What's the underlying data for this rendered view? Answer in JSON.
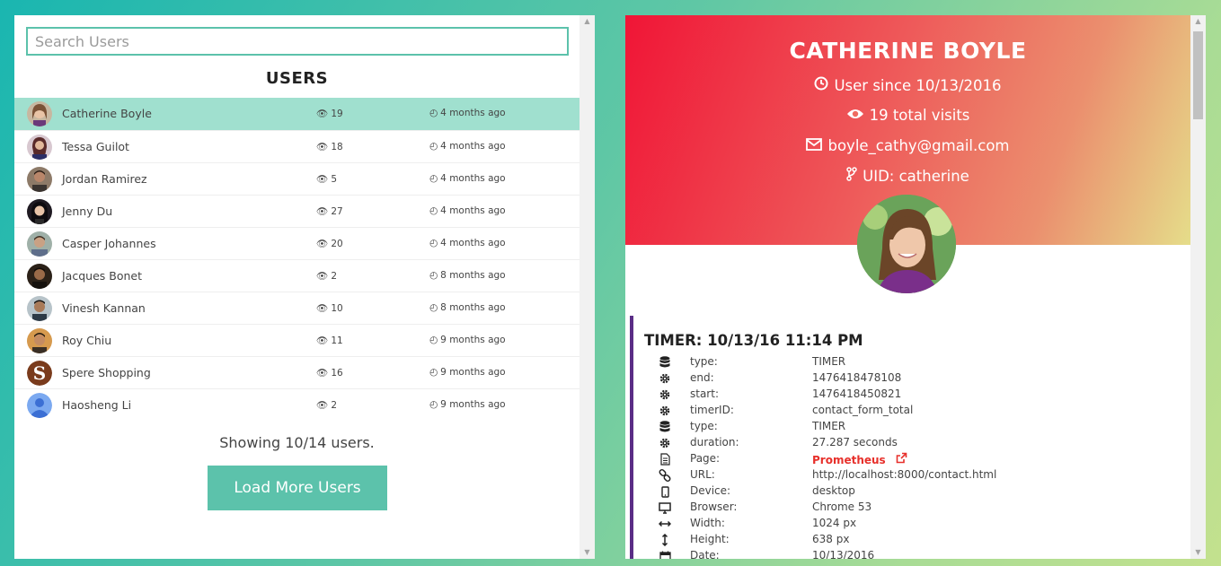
{
  "search": {
    "placeholder": "Search Users"
  },
  "users_title": "USERS",
  "users": [
    {
      "name": "Catherine Boyle",
      "visits": "19",
      "last_seen": "4 months ago",
      "selected": true
    },
    {
      "name": "Tessa Guilot",
      "visits": "18",
      "last_seen": "4 months ago"
    },
    {
      "name": "Jordan Ramirez",
      "visits": "5",
      "last_seen": "4 months ago"
    },
    {
      "name": "Jenny Du",
      "visits": "27",
      "last_seen": "4 months ago"
    },
    {
      "name": "Casper Johannes",
      "visits": "20",
      "last_seen": "4 months ago"
    },
    {
      "name": "Jacques Bonet",
      "visits": "2",
      "last_seen": "8 months ago"
    },
    {
      "name": "Vinesh Kannan",
      "visits": "10",
      "last_seen": "8 months ago"
    },
    {
      "name": "Roy Chiu",
      "visits": "11",
      "last_seen": "9 months ago"
    },
    {
      "name": "Spere Shopping",
      "visits": "16",
      "last_seen": "9 months ago"
    },
    {
      "name": "Haosheng Li",
      "visits": "2",
      "last_seen": "9 months ago"
    }
  ],
  "showing_text": "Showing 10/14 users.",
  "load_more_label": "Load More Users",
  "profile": {
    "name": "CATHERINE BOYLE",
    "user_since": "User since 10/13/2016",
    "total_visits": "19 total visits",
    "email": "boyle_cathy@gmail.com",
    "uid": "UID: catherine"
  },
  "event": {
    "title": "TIMER: 10/13/16 11:14 PM",
    "rows": [
      {
        "icon": "database-icon",
        "key": "type:",
        "value": "TIMER"
      },
      {
        "icon": "gear-icon",
        "key": "end:",
        "value": "1476418478108"
      },
      {
        "icon": "gear-icon",
        "key": "start:",
        "value": "1476418450821"
      },
      {
        "icon": "gear-icon",
        "key": "timerID:",
        "value": "contact_form_total"
      },
      {
        "icon": "database-icon",
        "key": "type:",
        "value": "TIMER"
      },
      {
        "icon": "gear-icon",
        "key": "duration:",
        "value": "27.287 seconds"
      },
      {
        "icon": "file-icon",
        "key": "Page:",
        "value": "Prometheus",
        "link": true
      },
      {
        "icon": "link-icon",
        "key": "URL:",
        "value": "http://localhost:8000/contact.html"
      },
      {
        "icon": "mobile-icon",
        "key": "Device:",
        "value": "desktop"
      },
      {
        "icon": "monitor-icon",
        "key": "Browser:",
        "value": "Chrome 53"
      },
      {
        "icon": "arrows-h-icon",
        "key": "Width:",
        "value": "1024 px"
      },
      {
        "icon": "arrows-v-icon",
        "key": "Height:",
        "value": "638 px"
      },
      {
        "icon": "calendar-icon",
        "key": "Date:",
        "value": "10/13/2016"
      }
    ]
  },
  "colors": {
    "accent": "#5cc2ab",
    "selected_row": "#a0e0cf",
    "event_border": "#5a2d86",
    "link": "#e7302b"
  }
}
